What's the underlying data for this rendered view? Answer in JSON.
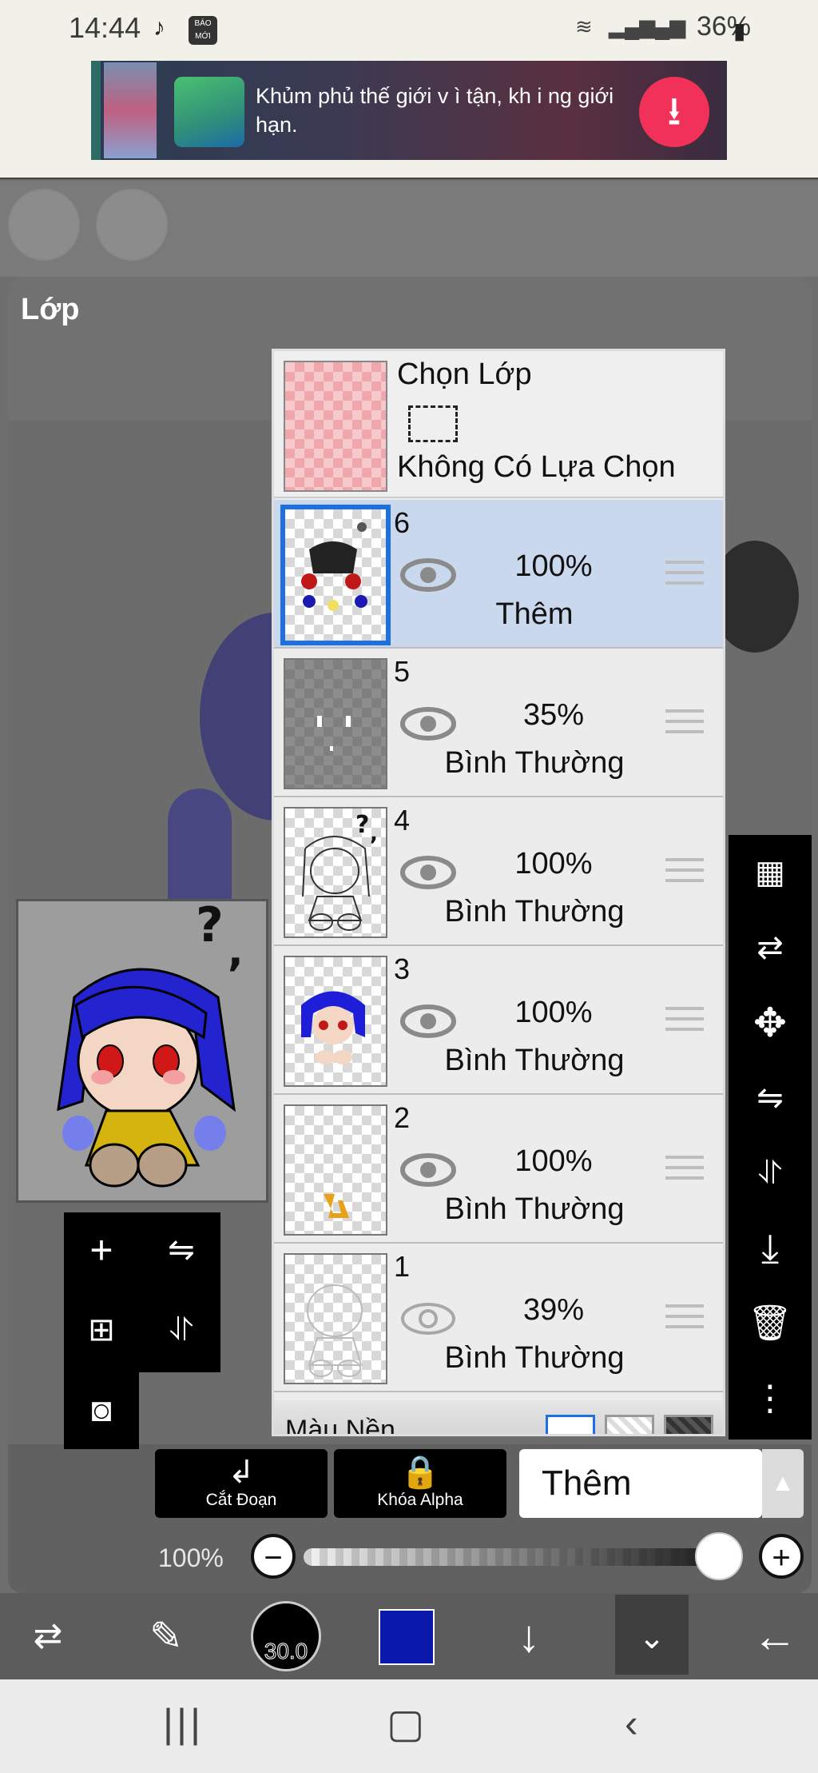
{
  "status_bar": {
    "time": "14:44",
    "tiktok_icon": "tiktok-icon",
    "baomoi_label": "BÁO MỚI",
    "battery": "36%"
  },
  "ad": {
    "text": "Khủm phủ thế giới v ì tận, kh i ng giới hạn.",
    "download_icon": "download-icon"
  },
  "layer_window": {
    "title": "Lớp"
  },
  "selection_row": {
    "title": "Chọn Lớp",
    "status": "Không Có Lựa Chọn"
  },
  "layers": [
    {
      "num": "6",
      "opacity": "100%",
      "mode": "Thêm",
      "visible": true
    },
    {
      "num": "5",
      "opacity": "35%",
      "mode": "Bình Thường",
      "visible": true
    },
    {
      "num": "4",
      "opacity": "100%",
      "mode": "Bình Thường",
      "visible": true
    },
    {
      "num": "3",
      "opacity": "100%",
      "mode": "Bình Thường",
      "visible": true
    },
    {
      "num": "2",
      "opacity": "100%",
      "mode": "Bình Thường",
      "visible": true
    },
    {
      "num": "1",
      "opacity": "39%",
      "mode": "Bình Thường",
      "visible": false
    }
  ],
  "background_row": {
    "label": "Màu Nền"
  },
  "buttons": {
    "clip_label": "Cắt Đoạn",
    "alpha_lock_label": "Khóa Alpha"
  },
  "blend_mode": {
    "value": "Thêm"
  },
  "opacity": {
    "label": "100%",
    "value": 1.0
  },
  "brush": {
    "size": "30.0"
  },
  "colors": {
    "primary": "#0a18ac",
    "active_layer_border": "#1e6fe0",
    "active_layer_bg": "#cad8ee",
    "ad_button": "#f2315a"
  }
}
